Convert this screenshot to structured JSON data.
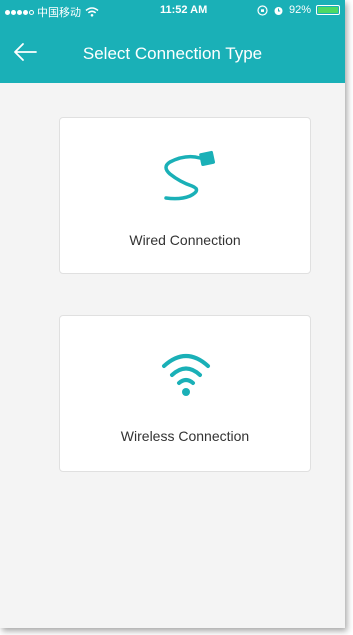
{
  "status_bar": {
    "carrier": "中国移动",
    "time": "11:52 AM",
    "battery": "92%",
    "battery_level": 0.92
  },
  "header": {
    "title": "Select Connection Type",
    "back_icon": "arrow-left-icon"
  },
  "options": [
    {
      "label": "Wired Connection",
      "icon": "ethernet-cable-icon"
    },
    {
      "label": "Wireless Connection",
      "icon": "wifi-icon"
    }
  ],
  "colors": {
    "accent": "#1ab0b7",
    "background": "#f4f4f4",
    "card": "#ffffff",
    "text": "#333333"
  }
}
